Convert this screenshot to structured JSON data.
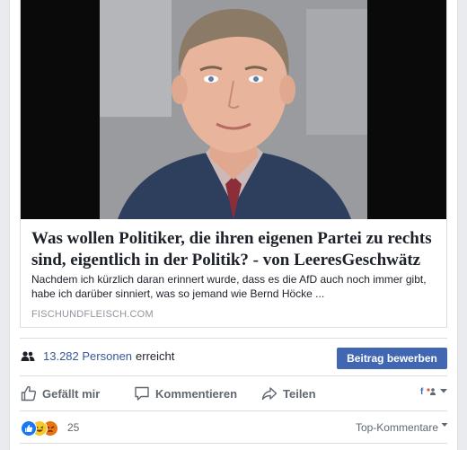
{
  "post": {
    "link": {
      "headline": "Was wollen Politiker, die ihren eigenen Partei zu rechts sind, eigentlich in der Politik? - von LeeresGeschwätz",
      "description": "Nachdem ich kürzlich daran erinnert wurde, dass es die AfD auch noch immer gibt, habe ich darüber sinniert, was so jemand wie Bernd Höcke ...",
      "domain": "FISCHUNDFLEISCH.COM"
    },
    "reach": {
      "count": "13.282 Personen",
      "suffix": "erreicht"
    },
    "boost_label": "Beitrag bewerben",
    "actions": {
      "like": "Gefällt mir",
      "comment": "Kommentieren",
      "share": "Teilen"
    },
    "reactions": {
      "count": "25",
      "icons": [
        "like-icon",
        "haha-icon",
        "angry-icon"
      ]
    },
    "comments_sort": "Top-Kommentare"
  },
  "colors": {
    "link_blue": "#365899",
    "button_blue": "#4267b2",
    "muted_text": "#606770"
  }
}
